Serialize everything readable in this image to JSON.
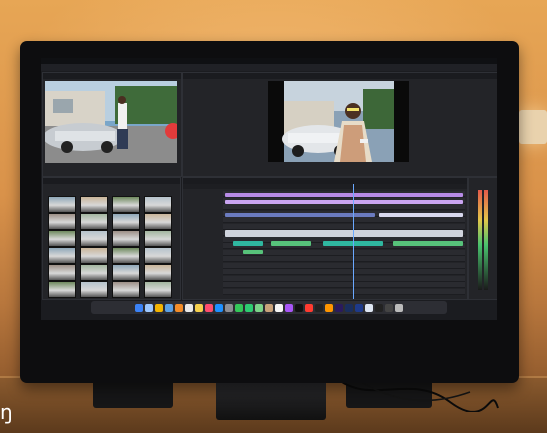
{
  "scene": {
    "description_colors": {
      "wall": "#d9924a",
      "desk": "#6b4423",
      "monitor_bezel": "#0d0d0f",
      "accent_blue": "#6aa8ff",
      "timecode_cyan": "#4fd1ff",
      "clip_purple": "#b78be6",
      "clip_teal": "#2fb7a0",
      "clip_green": "#57c27a"
    }
  },
  "app": {
    "menu": [],
    "workspaces": [],
    "active_workspace_index": 1
  },
  "panels": {
    "source_monitor": {
      "tabs": []
    },
    "program_monitor": {
      "tabs": []
    },
    "project": {
      "tabs": []
    },
    "timeline": {
      "tabs": []
    }
  },
  "dock": {
    "icons": [
      "finder-icon",
      "safari-icon",
      "chrome-icon",
      "mail-icon",
      "photos-icon",
      "calendar-icon",
      "notes-icon",
      "music-icon",
      "appstore-icon",
      "settings-icon",
      "messages-icon",
      "facetime-icon",
      "maps-icon",
      "contacts-icon",
      "reminders-icon",
      "podcasts-icon",
      "tv-icon",
      "news-icon",
      "stocks-icon",
      "books-icon",
      "premiere-icon",
      "lightroom-icon",
      "photoshop-icon",
      "preview-icon",
      "terminal-icon",
      "activity-icon",
      "trash-icon"
    ]
  },
  "overlay": {
    "corner_glyph": "ŋ"
  }
}
